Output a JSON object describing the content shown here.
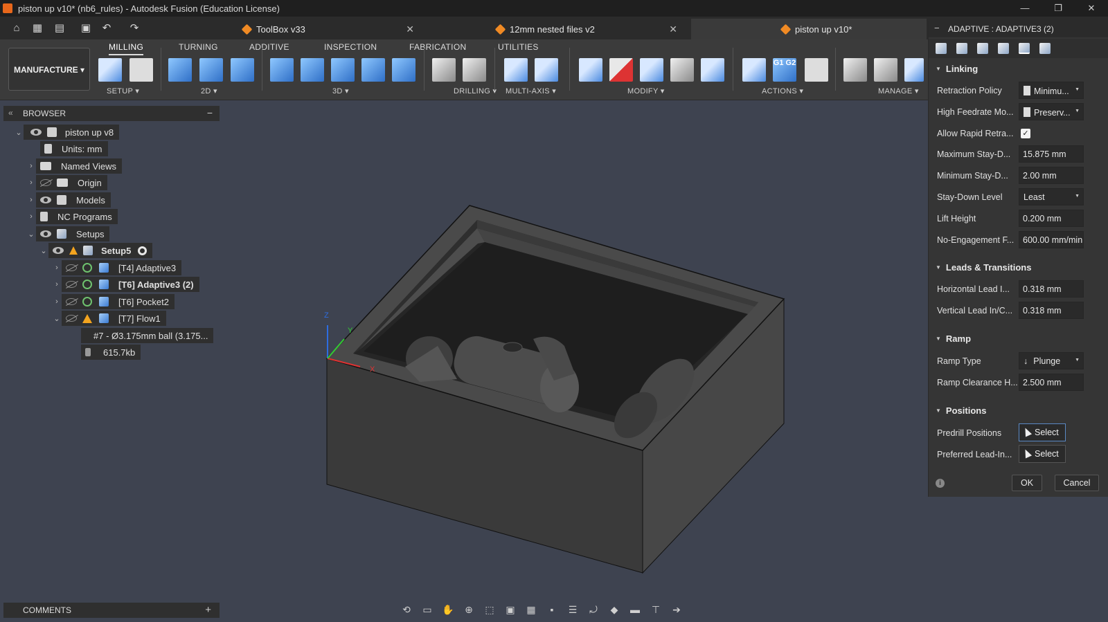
{
  "window": {
    "title": "piston up v10* (nb6_rules) - Autodesk Fusion (Education License)",
    "minimize": "—",
    "maximize": "❐",
    "close": "✕"
  },
  "tabs": [
    {
      "label": "ToolBox v33",
      "close": "✕"
    },
    {
      "label": "12mm nested files v2",
      "close": "✕"
    },
    {
      "label": "piston up v10*"
    }
  ],
  "workspace": {
    "label": "MANUFACTURE ▾"
  },
  "ribbon_tabs": [
    "MILLING",
    "TURNING",
    "ADDITIVE",
    "INSPECTION",
    "FABRICATION",
    "UTILITIES"
  ],
  "ribbon_groups": [
    "SETUP ▾",
    "2D ▾",
    "3D ▾",
    "DRILLING ▾",
    "MULTI-AXIS ▾",
    "MODIFY ▾",
    "ACTIONS ▾",
    "MANAGE ▾"
  ],
  "action_icons": {
    "g1g2": "G1 G2"
  },
  "browser": {
    "header": "BROWSER",
    "nodes": [
      {
        "label": "piston up v8"
      },
      {
        "label": "Units: mm"
      },
      {
        "label": "Named Views"
      },
      {
        "label": "Origin"
      },
      {
        "label": "Models"
      },
      {
        "label": "NC Programs"
      },
      {
        "label": "Setups"
      },
      {
        "label": "Setup5"
      },
      {
        "label": "[T4] Adaptive3"
      },
      {
        "label": "[T6] Adaptive3 (2)"
      },
      {
        "label": "[T6] Pocket2"
      },
      {
        "label": "[T7] Flow1"
      },
      {
        "label": "#7 - Ø3.175mm ball (3.175..."
      },
      {
        "label": "615.7kb"
      }
    ]
  },
  "comments": {
    "header": "COMMENTS",
    "add": "+"
  },
  "viewcube_axes": {
    "z": "Z",
    "y": "Y",
    "x": "X"
  },
  "panel": {
    "title": "ADAPTIVE : ADAPTIVE3 (2)",
    "sections": {
      "linking": "Linking",
      "leads": "Leads & Transitions",
      "ramp": "Ramp",
      "positions": "Positions"
    },
    "fields": {
      "retraction_policy": {
        "label": "Retraction Policy",
        "value": "Minimu..."
      },
      "high_feedrate": {
        "label": "High Feedrate Mo...",
        "value": "Preserv..."
      },
      "allow_rapid": {
        "label": "Allow Rapid Retra...",
        "checked": "✓"
      },
      "max_stay_down": {
        "label": "Maximum Stay-D...",
        "value": "15.875 mm"
      },
      "min_stay_down": {
        "label": "Minimum Stay-D...",
        "value": "2.00 mm"
      },
      "stay_down_level": {
        "label": "Stay-Down Level",
        "value": "Least"
      },
      "lift_height": {
        "label": "Lift Height",
        "value": "0.200 mm"
      },
      "no_engagement": {
        "label": "No-Engagement F...",
        "value": "600.00 mm/min"
      },
      "horiz_lead": {
        "label": "Horizontal Lead I...",
        "value": "0.318 mm"
      },
      "vert_lead": {
        "label": "Vertical Lead In/C...",
        "value": "0.318 mm"
      },
      "ramp_type": {
        "label": "Ramp Type",
        "value": "Plunge"
      },
      "ramp_clearance": {
        "label": "Ramp Clearance H...",
        "value": "2.500 mm"
      },
      "predrill": {
        "label": "Predrill Positions",
        "button": "Select"
      },
      "preferred_lead": {
        "label": "Preferred Lead-In...",
        "button": "Select"
      }
    },
    "ok": "OK",
    "cancel": "Cancel",
    "info": "i"
  }
}
